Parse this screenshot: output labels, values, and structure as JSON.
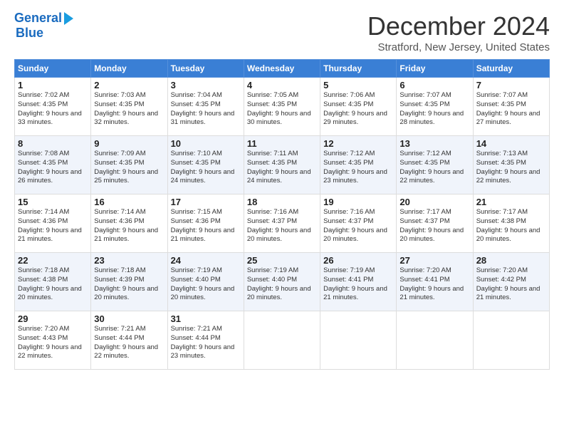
{
  "header": {
    "logo_line1": "General",
    "logo_line2": "Blue",
    "month_title": "December 2024",
    "location": "Stratford, New Jersey, United States"
  },
  "days_of_week": [
    "Sunday",
    "Monday",
    "Tuesday",
    "Wednesday",
    "Thursday",
    "Friday",
    "Saturday"
  ],
  "weeks": [
    [
      {
        "day": "1",
        "sunrise": "7:02 AM",
        "sunset": "4:35 PM",
        "daylight": "9 hours and 33 minutes."
      },
      {
        "day": "2",
        "sunrise": "7:03 AM",
        "sunset": "4:35 PM",
        "daylight": "9 hours and 32 minutes."
      },
      {
        "day": "3",
        "sunrise": "7:04 AM",
        "sunset": "4:35 PM",
        "daylight": "9 hours and 31 minutes."
      },
      {
        "day": "4",
        "sunrise": "7:05 AM",
        "sunset": "4:35 PM",
        "daylight": "9 hours and 30 minutes."
      },
      {
        "day": "5",
        "sunrise": "7:06 AM",
        "sunset": "4:35 PM",
        "daylight": "9 hours and 29 minutes."
      },
      {
        "day": "6",
        "sunrise": "7:07 AM",
        "sunset": "4:35 PM",
        "daylight": "9 hours and 28 minutes."
      },
      {
        "day": "7",
        "sunrise": "7:07 AM",
        "sunset": "4:35 PM",
        "daylight": "9 hours and 27 minutes."
      }
    ],
    [
      {
        "day": "8",
        "sunrise": "7:08 AM",
        "sunset": "4:35 PM",
        "daylight": "9 hours and 26 minutes."
      },
      {
        "day": "9",
        "sunrise": "7:09 AM",
        "sunset": "4:35 PM",
        "daylight": "9 hours and 25 minutes."
      },
      {
        "day": "10",
        "sunrise": "7:10 AM",
        "sunset": "4:35 PM",
        "daylight": "9 hours and 24 minutes."
      },
      {
        "day": "11",
        "sunrise": "7:11 AM",
        "sunset": "4:35 PM",
        "daylight": "9 hours and 24 minutes."
      },
      {
        "day": "12",
        "sunrise": "7:12 AM",
        "sunset": "4:35 PM",
        "daylight": "9 hours and 23 minutes."
      },
      {
        "day": "13",
        "sunrise": "7:12 AM",
        "sunset": "4:35 PM",
        "daylight": "9 hours and 22 minutes."
      },
      {
        "day": "14",
        "sunrise": "7:13 AM",
        "sunset": "4:35 PM",
        "daylight": "9 hours and 22 minutes."
      }
    ],
    [
      {
        "day": "15",
        "sunrise": "7:14 AM",
        "sunset": "4:36 PM",
        "daylight": "9 hours and 21 minutes."
      },
      {
        "day": "16",
        "sunrise": "7:14 AM",
        "sunset": "4:36 PM",
        "daylight": "9 hours and 21 minutes."
      },
      {
        "day": "17",
        "sunrise": "7:15 AM",
        "sunset": "4:36 PM",
        "daylight": "9 hours and 21 minutes."
      },
      {
        "day": "18",
        "sunrise": "7:16 AM",
        "sunset": "4:37 PM",
        "daylight": "9 hours and 20 minutes."
      },
      {
        "day": "19",
        "sunrise": "7:16 AM",
        "sunset": "4:37 PM",
        "daylight": "9 hours and 20 minutes."
      },
      {
        "day": "20",
        "sunrise": "7:17 AM",
        "sunset": "4:37 PM",
        "daylight": "9 hours and 20 minutes."
      },
      {
        "day": "21",
        "sunrise": "7:17 AM",
        "sunset": "4:38 PM",
        "daylight": "9 hours and 20 minutes."
      }
    ],
    [
      {
        "day": "22",
        "sunrise": "7:18 AM",
        "sunset": "4:38 PM",
        "daylight": "9 hours and 20 minutes."
      },
      {
        "day": "23",
        "sunrise": "7:18 AM",
        "sunset": "4:39 PM",
        "daylight": "9 hours and 20 minutes."
      },
      {
        "day": "24",
        "sunrise": "7:19 AM",
        "sunset": "4:40 PM",
        "daylight": "9 hours and 20 minutes."
      },
      {
        "day": "25",
        "sunrise": "7:19 AM",
        "sunset": "4:40 PM",
        "daylight": "9 hours and 20 minutes."
      },
      {
        "day": "26",
        "sunrise": "7:19 AM",
        "sunset": "4:41 PM",
        "daylight": "9 hours and 21 minutes."
      },
      {
        "day": "27",
        "sunrise": "7:20 AM",
        "sunset": "4:41 PM",
        "daylight": "9 hours and 21 minutes."
      },
      {
        "day": "28",
        "sunrise": "7:20 AM",
        "sunset": "4:42 PM",
        "daylight": "9 hours and 21 minutes."
      }
    ],
    [
      {
        "day": "29",
        "sunrise": "7:20 AM",
        "sunset": "4:43 PM",
        "daylight": "9 hours and 22 minutes."
      },
      {
        "day": "30",
        "sunrise": "7:21 AM",
        "sunset": "4:44 PM",
        "daylight": "9 hours and 22 minutes."
      },
      {
        "day": "31",
        "sunrise": "7:21 AM",
        "sunset": "4:44 PM",
        "daylight": "9 hours and 23 minutes."
      },
      null,
      null,
      null,
      null
    ]
  ]
}
